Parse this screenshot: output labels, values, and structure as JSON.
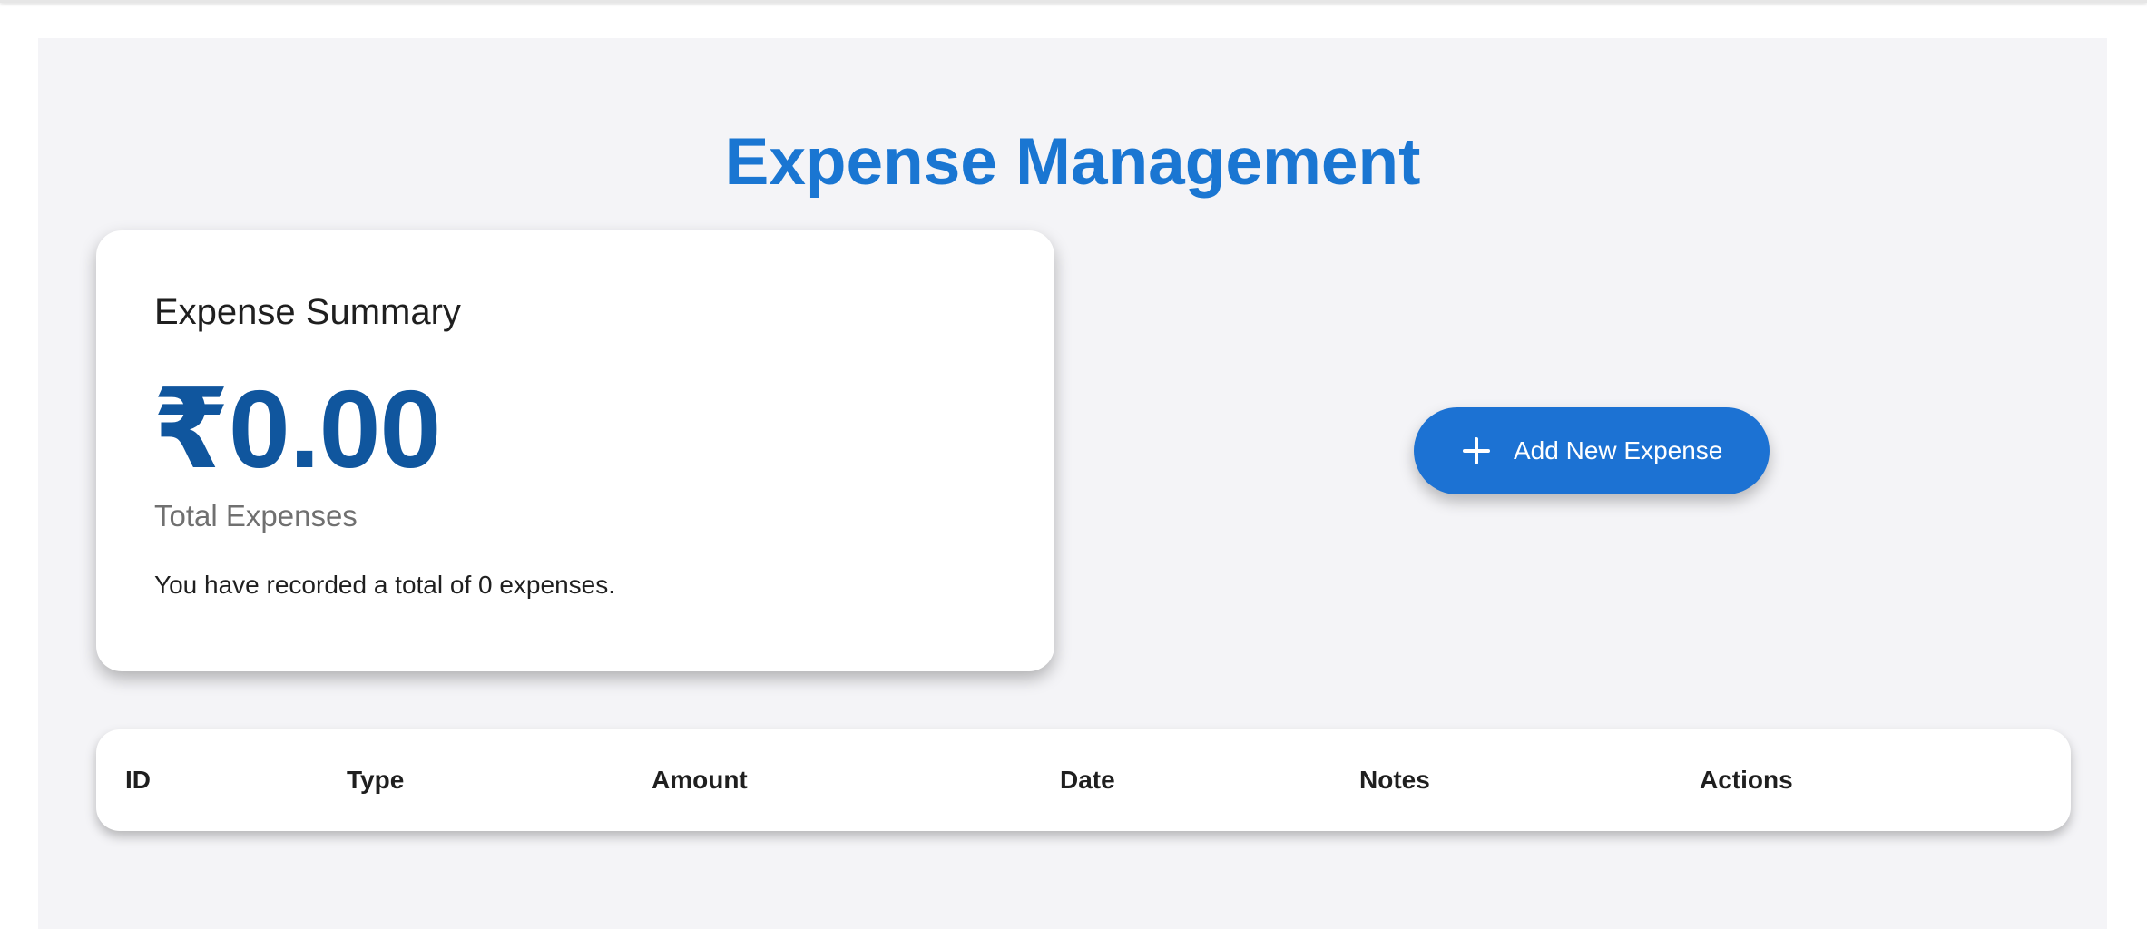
{
  "page": {
    "title": "Expense Management"
  },
  "summary": {
    "title": "Expense Summary",
    "amount": "₹0.00",
    "caption": "Total Expenses",
    "note": "You have recorded a total of 0 expenses."
  },
  "actions": {
    "add_label": "Add New Expense",
    "add_icon": "plus-icon"
  },
  "table": {
    "columns": [
      "ID",
      "Type",
      "Amount",
      "Date",
      "Notes",
      "Actions"
    ],
    "rows": []
  },
  "colors": {
    "accent": "#1a76d2",
    "amount": "#10569e",
    "background": "#f4f4f7"
  }
}
